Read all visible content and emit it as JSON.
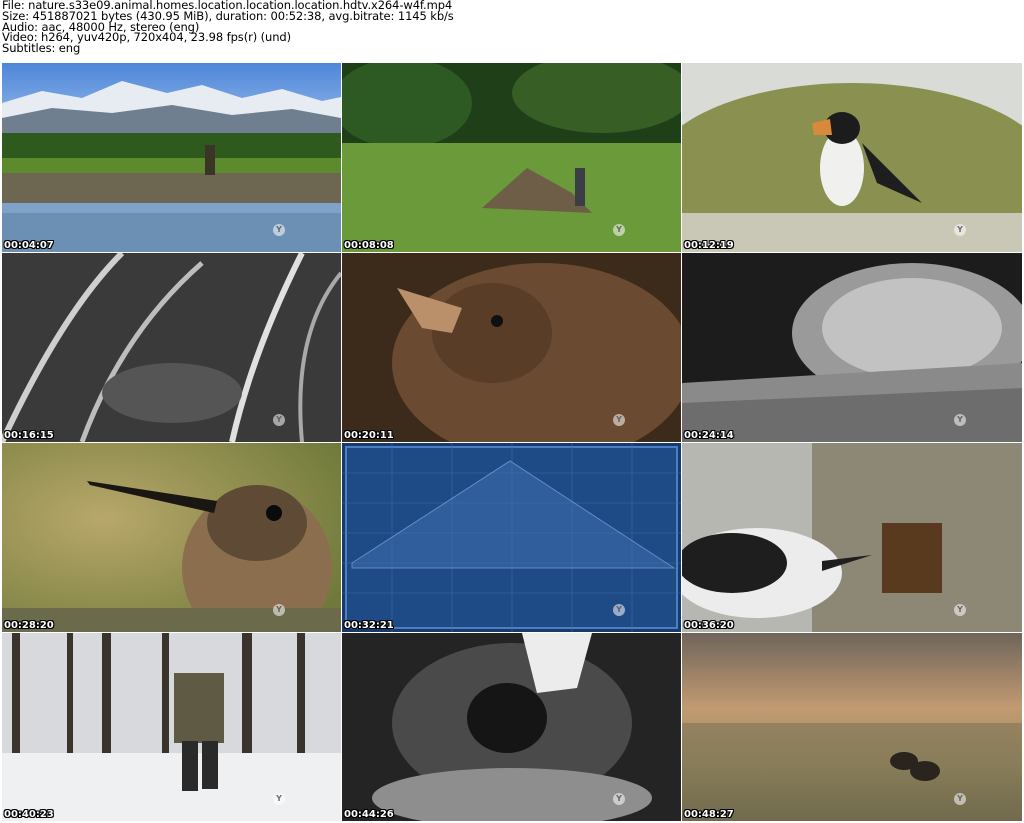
{
  "info": {
    "file": "File: nature.s33e09.animal.homes.location.location.location.hdtv.x264-w4f.mp4",
    "size": "Size: 451887021 bytes (430.95 MiB), duration: 00:52:38, avg.bitrate: 1145 kb/s",
    "audio": "Audio: aac, 48000 Hz, stereo (eng)",
    "video": "Video: h264, yuv420p, 720x404, 23.98 fps(r) (und)",
    "subtitles": "Subtitles: eng"
  },
  "thumbnails": [
    {
      "timestamp": "00:04:07",
      "scene": "beaver-dam-mountains"
    },
    {
      "timestamp": "00:08:08",
      "scene": "beaver-lodge-meadow"
    },
    {
      "timestamp": "00:12:19",
      "scene": "puffin-on-rock"
    },
    {
      "timestamp": "00:16:15",
      "scene": "night-vision-grass-nest"
    },
    {
      "timestamp": "00:20:11",
      "scene": "chick-closeup"
    },
    {
      "timestamp": "00:24:14",
      "scene": "night-vision-branch-nest"
    },
    {
      "timestamp": "00:28:20",
      "scene": "hummingbird-closeup"
    },
    {
      "timestamp": "00:32:21",
      "scene": "blueprint-roof-diagram"
    },
    {
      "timestamp": "00:36:20",
      "scene": "chickadee-tree-hole"
    },
    {
      "timestamp": "00:40:23",
      "scene": "man-walking-snowy-forest"
    },
    {
      "timestamp": "00:44:26",
      "scene": "night-vision-burrow"
    },
    {
      "timestamp": "00:48:27",
      "scene": "animals-grazing-misty-field"
    }
  ],
  "watermark_glyph": "Y"
}
